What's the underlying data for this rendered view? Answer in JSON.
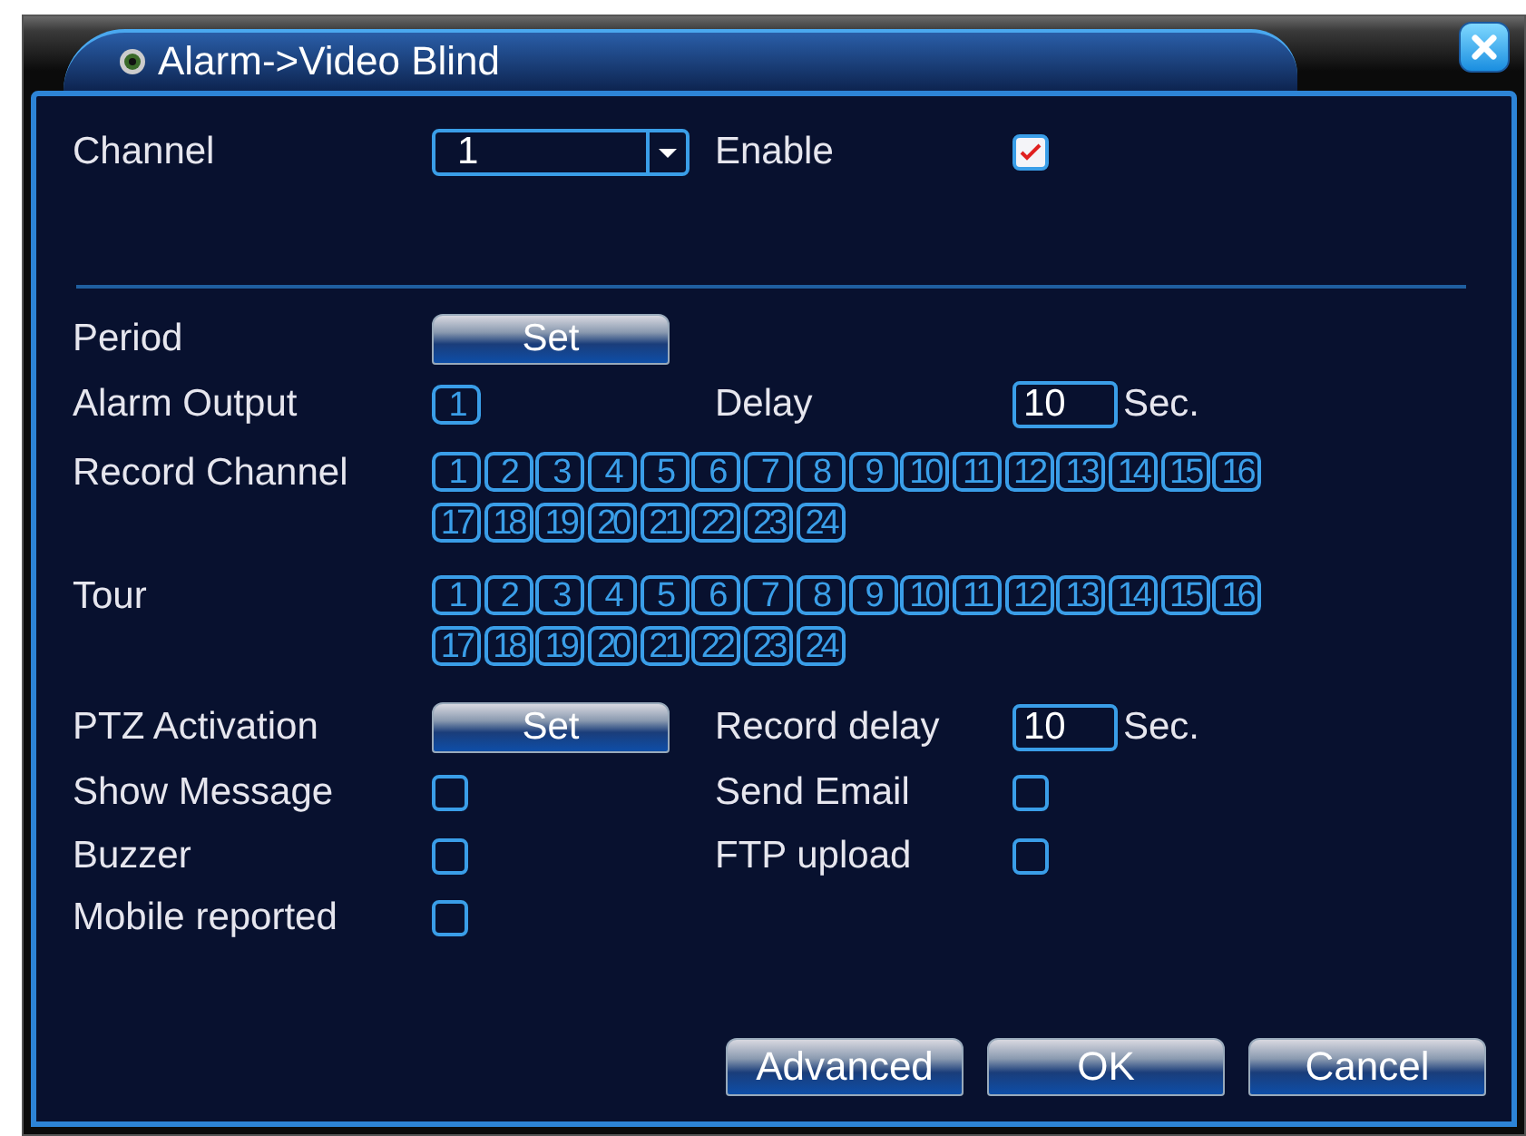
{
  "window": {
    "title": "Alarm->Video Blind"
  },
  "channel": {
    "label": "Channel",
    "value": "1"
  },
  "enable": {
    "label": "Enable",
    "checked": true
  },
  "period": {
    "label": "Period",
    "button": "Set"
  },
  "alarm_output": {
    "label": "Alarm Output",
    "boxes": [
      {
        "label": "1",
        "selected": false
      }
    ]
  },
  "delay": {
    "label": "Delay",
    "value": "10",
    "unit": "Sec."
  },
  "record_channel": {
    "label": "Record Channel",
    "boxes": [
      {
        "label": "1",
        "selected": false
      },
      {
        "label": "2",
        "selected": false
      },
      {
        "label": "3",
        "selected": false
      },
      {
        "label": "4",
        "selected": false
      },
      {
        "label": "5",
        "selected": false
      },
      {
        "label": "6",
        "selected": false
      },
      {
        "label": "7",
        "selected": false
      },
      {
        "label": "8",
        "selected": false
      },
      {
        "label": "9",
        "selected": false
      },
      {
        "label": "10",
        "selected": false
      },
      {
        "label": "11",
        "selected": false
      },
      {
        "label": "12",
        "selected": false
      },
      {
        "label": "13",
        "selected": false
      },
      {
        "label": "14",
        "selected": false
      },
      {
        "label": "15",
        "selected": false
      },
      {
        "label": "16",
        "selected": false
      },
      {
        "label": "17",
        "selected": false
      },
      {
        "label": "18",
        "selected": false
      },
      {
        "label": "19",
        "selected": false
      },
      {
        "label": "20",
        "selected": false
      },
      {
        "label": "21",
        "selected": false
      },
      {
        "label": "22",
        "selected": false
      },
      {
        "label": "23",
        "selected": false
      },
      {
        "label": "24",
        "selected": false
      }
    ]
  },
  "tour": {
    "label": "Tour",
    "boxes": [
      {
        "label": "1",
        "selected": false
      },
      {
        "label": "2",
        "selected": false
      },
      {
        "label": "3",
        "selected": false
      },
      {
        "label": "4",
        "selected": false
      },
      {
        "label": "5",
        "selected": false
      },
      {
        "label": "6",
        "selected": false
      },
      {
        "label": "7",
        "selected": false
      },
      {
        "label": "8",
        "selected": false
      },
      {
        "label": "9",
        "selected": false
      },
      {
        "label": "10",
        "selected": false
      },
      {
        "label": "11",
        "selected": false
      },
      {
        "label": "12",
        "selected": false
      },
      {
        "label": "13",
        "selected": false
      },
      {
        "label": "14",
        "selected": false
      },
      {
        "label": "15",
        "selected": false
      },
      {
        "label": "16",
        "selected": false
      },
      {
        "label": "17",
        "selected": false
      },
      {
        "label": "18",
        "selected": false
      },
      {
        "label": "19",
        "selected": false
      },
      {
        "label": "20",
        "selected": false
      },
      {
        "label": "21",
        "selected": false
      },
      {
        "label": "22",
        "selected": false
      },
      {
        "label": "23",
        "selected": false
      },
      {
        "label": "24",
        "selected": false
      }
    ]
  },
  "ptz_activation": {
    "label": "PTZ Activation",
    "button": "Set"
  },
  "record_delay": {
    "label": "Record delay",
    "value": "10",
    "unit": "Sec."
  },
  "options": [
    {
      "label": "Show Message",
      "checked": false
    },
    {
      "label": "Send Email",
      "checked": false
    },
    {
      "label": "Buzzer",
      "checked": false
    },
    {
      "label": "FTP upload",
      "checked": false
    },
    {
      "label": "Mobile reported",
      "checked": false
    }
  ],
  "buttons": [
    "Advanced",
    "OK",
    "Cancel"
  ]
}
